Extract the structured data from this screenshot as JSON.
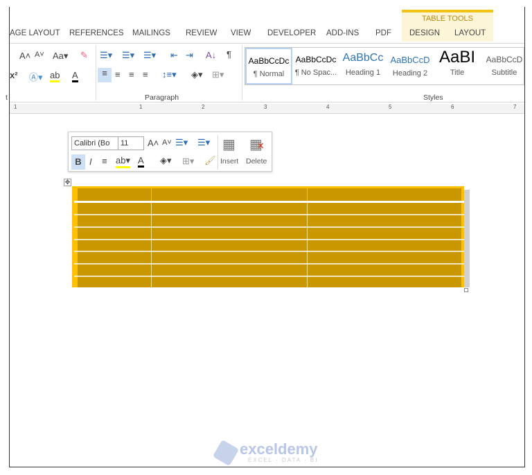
{
  "tabs": [
    "AGE LAYOUT",
    "REFERENCES",
    "MAILINGS",
    "REVIEW",
    "VIEW",
    "DEVELOPER",
    "ADD-INS",
    "PDF",
    "DESIGN",
    "LAYOUT"
  ],
  "table_tools": "TABLE TOOLS",
  "groups": {
    "font": "t",
    "paragraph": "Paragraph",
    "styles": "Styles"
  },
  "styles": [
    {
      "sample": "AaBbCcDc",
      "name": "¶ Normal",
      "color": "#000000"
    },
    {
      "sample": "AaBbCcDc",
      "name": "¶ No Spac...",
      "color": "#000000"
    },
    {
      "sample": "AaBbCc",
      "name": "Heading 1",
      "color": "#2e74b5"
    },
    {
      "sample": "AaBbCcD",
      "name": "Heading 2",
      "color": "#2e74b5"
    },
    {
      "sample": "AaBI",
      "name": "Title",
      "color": "#000000"
    },
    {
      "sample": "AaBbCcD",
      "name": "Subtitle",
      "color": "#595959"
    }
  ],
  "ruler": [
    "1",
    "1",
    "2",
    "3",
    "4",
    "5",
    "6",
    "7"
  ],
  "mini_toolbar": {
    "font": "Calibri (Bo",
    "size": "11",
    "insert": "Insert",
    "delete": "Delete",
    "bold": "B",
    "italic": "I"
  },
  "table": {
    "rows": 8,
    "columns": 3,
    "fill": "#c99700",
    "border": "#ffc000"
  },
  "watermark": {
    "brand": "exceldemy",
    "tagline": "EXCEL · DATA · BI"
  }
}
